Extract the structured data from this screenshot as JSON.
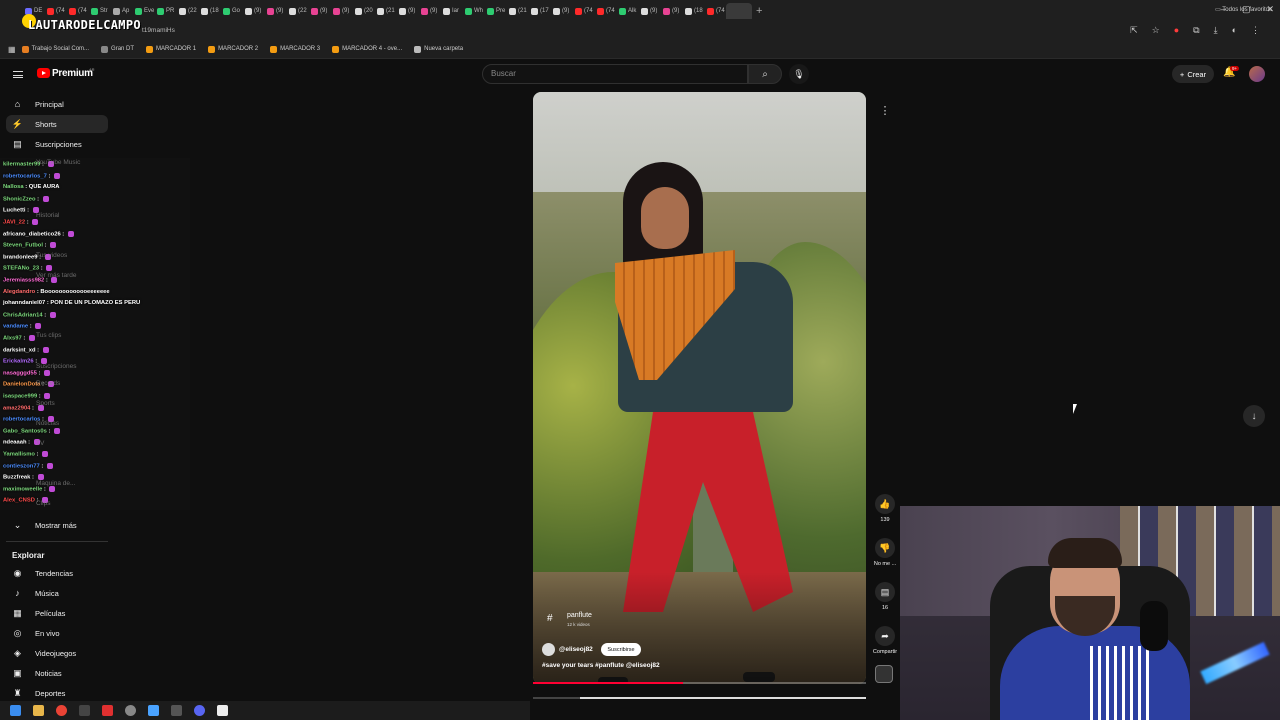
{
  "browser": {
    "streamer_name": "LAUTARODELCAMPO",
    "url_fragment": "t19mamiHs",
    "tabs": [
      {
        "label": "DE",
        "color": "#6b6bff"
      },
      {
        "label": "(74",
        "color": "#ff2a2a"
      },
      {
        "label": "(74",
        "color": "#ff2a2a"
      },
      {
        "label": "Str",
        "color": "#2ecc71"
      },
      {
        "label": "Ap",
        "color": "#aaaaaa"
      },
      {
        "label": "Eve",
        "color": "#2ecc71"
      },
      {
        "label": "PR",
        "color": "#2ecc71"
      },
      {
        "label": "(22",
        "color": "#dddddd"
      },
      {
        "label": "(18",
        "color": "#dddddd"
      },
      {
        "label": "Go",
        "color": "#2ecc71"
      },
      {
        "label": "(9)",
        "color": "#dddddd"
      },
      {
        "label": "(9)",
        "color": "#e84393"
      },
      {
        "label": "(22",
        "color": "#dddddd"
      },
      {
        "label": "(9)",
        "color": "#e84393"
      },
      {
        "label": "(9)",
        "color": "#e84393"
      },
      {
        "label": "(20",
        "color": "#dddddd"
      },
      {
        "label": "(21",
        "color": "#dddddd"
      },
      {
        "label": "(9)",
        "color": "#dddddd"
      },
      {
        "label": "(9)",
        "color": "#e84393"
      },
      {
        "label": "Iar",
        "color": "#dddddd"
      },
      {
        "label": "Wh",
        "color": "#2ecc71"
      },
      {
        "label": "Pre",
        "color": "#2ecc71"
      },
      {
        "label": "(21",
        "color": "#dddddd"
      },
      {
        "label": "(17",
        "color": "#dddddd"
      },
      {
        "label": "(9)",
        "color": "#dddddd"
      },
      {
        "label": "(74",
        "color": "#ff2a2a"
      },
      {
        "label": "(74",
        "color": "#ff2a2a"
      },
      {
        "label": "Alk",
        "color": "#2ecc71"
      },
      {
        "label": "(9)",
        "color": "#dddddd"
      },
      {
        "label": "(9)",
        "color": "#e84393"
      },
      {
        "label": "(18",
        "color": "#dddddd"
      },
      {
        "label": "(74",
        "color": "#ff2a2a"
      }
    ],
    "bookmarks": [
      {
        "label": "Trabajo Social Com...",
        "color": "#e67e22"
      },
      {
        "label": "Gran DT",
        "color": "#888888"
      },
      {
        "label": "MARCADOR 1",
        "color": "#f39c12"
      },
      {
        "label": "MARCADOR 2",
        "color": "#f39c12"
      },
      {
        "label": "MARCADOR 3",
        "color": "#f39c12"
      },
      {
        "label": "MARCADOR 4 - ove...",
        "color": "#f39c12"
      },
      {
        "label": "Nueva carpeta",
        "color": "#bbbbbb"
      }
    ],
    "bookmarks_right": "Todos los favoritos"
  },
  "youtube": {
    "logo_text": "Premium",
    "region": "AR",
    "search_placeholder": "Buscar",
    "create_label": "Crear",
    "notif_count": "9+",
    "sidebar": {
      "items": [
        {
          "label": "Principal",
          "icon": "home-icon",
          "glyph": "⌂"
        },
        {
          "label": "Shorts",
          "icon": "shorts-icon",
          "glyph": "⚡"
        },
        {
          "label": "Suscripciones",
          "icon": "subscriptions-icon",
          "glyph": "▤"
        }
      ],
      "faint_items": [
        "YouTube Music",
        "Historial",
        "Tus videos",
        "Ver más tarde",
        "Tus clips",
        "Suscripciones",
        "Records",
        "Sports",
        "Noticias",
        "TV",
        "Maquina de...",
        "Clips"
      ],
      "show_more": "Mostrar más",
      "explore_title": "Explorar",
      "explore": [
        {
          "label": "Tendencias",
          "icon": "trending-icon",
          "glyph": "◉"
        },
        {
          "label": "Música",
          "icon": "music-icon",
          "glyph": "♪"
        },
        {
          "label": "Películas",
          "icon": "movies-icon",
          "glyph": "▦"
        },
        {
          "label": "En vivo",
          "icon": "live-icon",
          "glyph": "◎"
        },
        {
          "label": "Videojuegos",
          "icon": "gaming-icon",
          "glyph": "◈"
        },
        {
          "label": "Noticias",
          "icon": "news-icon",
          "glyph": "▣"
        },
        {
          "label": "Deportes",
          "icon": "sports-icon",
          "glyph": "♜"
        }
      ]
    },
    "short": {
      "tag": "panflute",
      "tag_count": "12 k videos",
      "channel": "@eliseoj82",
      "subscribe": "Suscribirse",
      "caption": "#save your tears #panflute @eliseoj82",
      "progress": 0.45,
      "likes": "139",
      "dislike_label": "No me ...",
      "comments": "16",
      "share_label": "Compartir"
    }
  },
  "chat": [
    {
      "user": "kilermaster99",
      "msg": "",
      "color": "#7cd97c",
      "emote": true
    },
    {
      "user": "robertocarlos_7",
      "msg": "",
      "color": "#4a8cff",
      "emote": true
    },
    {
      "user": "Nallosa",
      "msg": "QUE AURA",
      "color": "#7cd97c",
      "emote": false
    },
    {
      "user": "ShonicZzeo",
      "msg": "",
      "color": "#7cd97c",
      "emote": true
    },
    {
      "user": "Luchetti",
      "msg": "",
      "color": "#ffffff",
      "emote": true
    },
    {
      "user": "JAVI_22",
      "msg": "",
      "color": "#ff4a4a",
      "emote": true
    },
    {
      "user": "africano_diabetico26",
      "msg": "",
      "color": "#ffffff",
      "emote": true
    },
    {
      "user": "Steven_Futbol",
      "msg": "",
      "color": "#7cd97c",
      "emote": true
    },
    {
      "user": "brandonlee9",
      "msg": "",
      "color": "#ffffff",
      "emote": true
    },
    {
      "user": "STEFANo_23",
      "msg": "",
      "color": "#7cd97c",
      "emote": true
    },
    {
      "user": "Jeremiasss982",
      "msg": "",
      "color": "#ff6ad5",
      "emote": true
    },
    {
      "user": "Alegdandro",
      "msg": "Booooooooooooeeeeeee",
      "color": "#ff6a6a",
      "emote": false
    },
    {
      "user": "johanndaniel07",
      "msg": "PON DE UN PLOMAZO ES PERU",
      "color": "#ffffff",
      "emote": false
    },
    {
      "user": "ChrisAdrian14",
      "msg": "",
      "color": "#7cd97c",
      "emote": true
    },
    {
      "user": "vandame",
      "msg": "",
      "color": "#4a8cff",
      "emote": true
    },
    {
      "user": "Alxs97",
      "msg": "",
      "color": "#7cd97c",
      "emote": true
    },
    {
      "user": "darksint_xd",
      "msg": "",
      "color": "#ffffff",
      "emote": true
    },
    {
      "user": "Erickalm26",
      "msg": "",
      "color": "#b36bff",
      "emote": true
    },
    {
      "user": "nasagggd55",
      "msg": "",
      "color": "#ff6ad5",
      "emote": true
    },
    {
      "user": "DanielonDota",
      "msg": "",
      "color": "#ff9a4a",
      "emote": true
    },
    {
      "user": "isaspace999",
      "msg": "",
      "color": "#7cd97c",
      "emote": true
    },
    {
      "user": "amaz2904",
      "msg": "",
      "color": "#ff6a6a",
      "emote": true
    },
    {
      "user": "robertocarlos",
      "msg": "",
      "color": "#4a8cff",
      "emote": true
    },
    {
      "user": "Gabo_Santos0s",
      "msg": "",
      "color": "#7cd97c",
      "emote": true
    },
    {
      "user": "ndeaaah",
      "msg": "",
      "color": "#ffffff",
      "emote": true
    },
    {
      "user": "Yamallismo",
      "msg": "",
      "color": "#7cd97c",
      "emote": true
    },
    {
      "user": "contieszon77",
      "msg": "",
      "color": "#4a8cff",
      "emote": true
    },
    {
      "user": "Buzzfreak",
      "msg": "",
      "color": "#ffffff",
      "emote": true
    },
    {
      "user": "maximoweelle",
      "msg": "",
      "color": "#7cd97c",
      "emote": true
    },
    {
      "user": "Alex_CNSD",
      "msg": "",
      "color": "#ff4a4a",
      "emote": true
    }
  ],
  "colors": {
    "yt_red": "#ff0000",
    "progress_red": "#ff0033",
    "panel": "#272727"
  }
}
